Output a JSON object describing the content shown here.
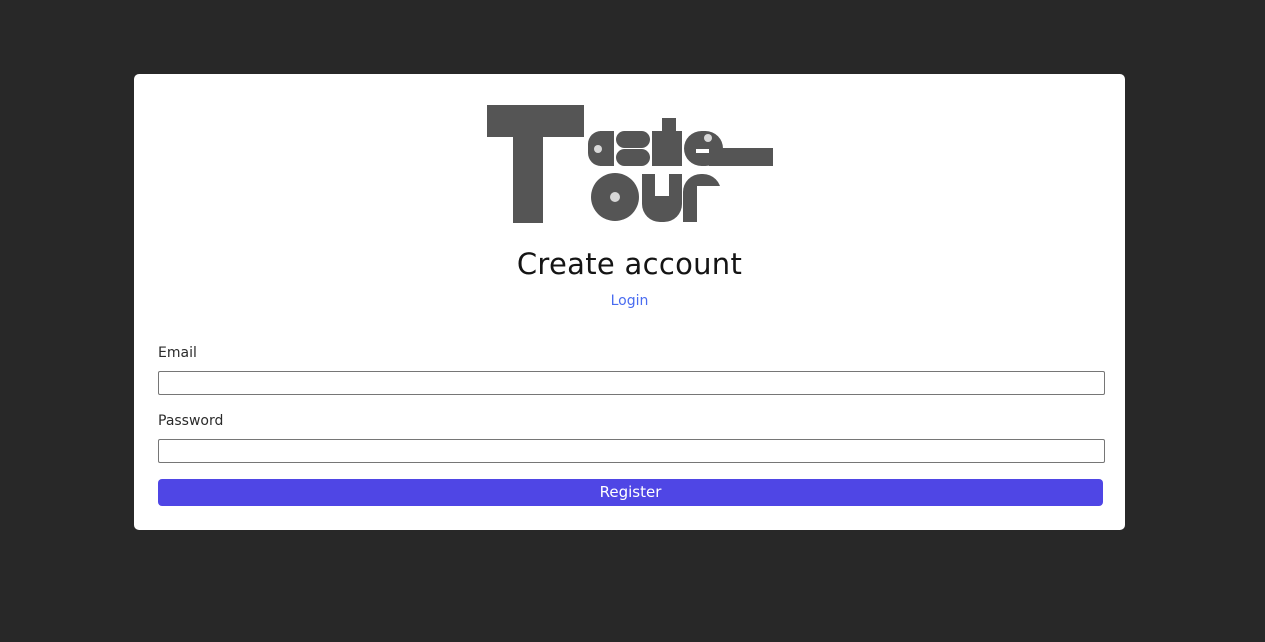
{
  "logo": {
    "name": "Taste Tour",
    "color": "#555555",
    "dot_color": "#d8d8d8"
  },
  "page": {
    "title": "Create account",
    "login_link": "Login"
  },
  "form": {
    "email_label": "Email",
    "email_value": "",
    "password_label": "Password",
    "password_value": "",
    "register_label": "Register"
  },
  "colors": {
    "background": "#282828",
    "card": "#ffffff",
    "accent": "#4f46e5",
    "link": "#4a6cf0"
  }
}
